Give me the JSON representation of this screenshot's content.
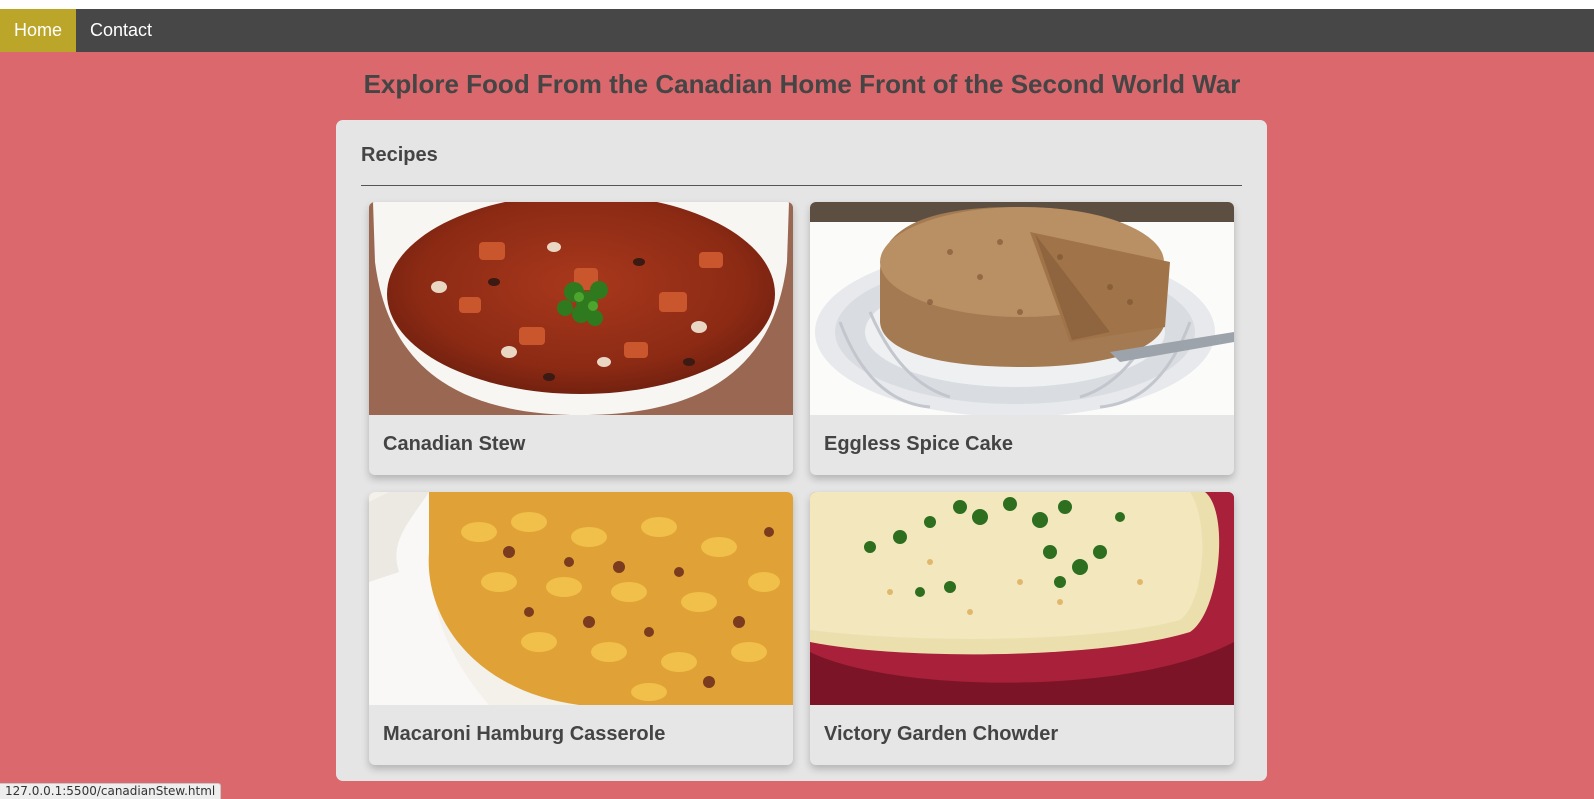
{
  "nav": {
    "items": [
      {
        "label": "Home",
        "active": true
      },
      {
        "label": "Contact",
        "active": false
      }
    ]
  },
  "page": {
    "title": "Explore Food From the Canadian Home Front of the Second World War"
  },
  "recipes": {
    "heading": "Recipes",
    "cards": [
      {
        "title": "Canadian Stew",
        "image": "stew-photo"
      },
      {
        "title": "Eggless Spice Cake",
        "image": "spice-cake-photo"
      },
      {
        "title": "Macaroni Hamburg Casserole",
        "image": "macaroni-casserole-photo"
      },
      {
        "title": "Victory Garden Chowder",
        "image": "chowder-photo"
      }
    ]
  },
  "status_bar": {
    "url": "127.0.0.1:5500/canadianStew.html"
  },
  "colors": {
    "background": "#db686c",
    "navbar": "#474747",
    "nav_active": "#bba62a",
    "panel": "#e5e5e5",
    "text": "#444444"
  }
}
